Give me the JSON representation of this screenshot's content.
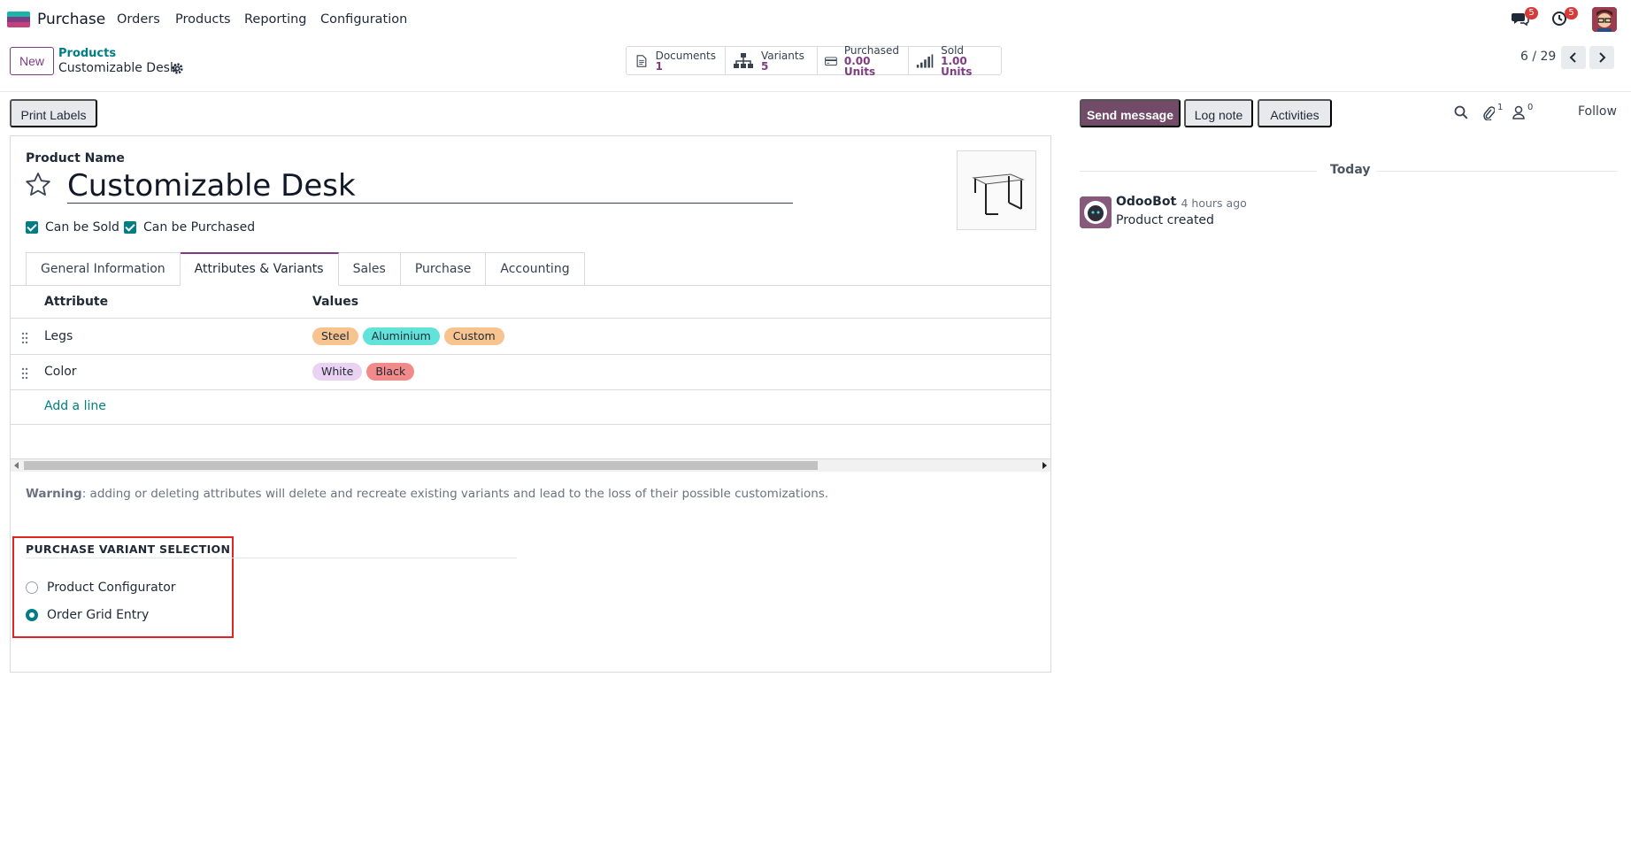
{
  "navbar": {
    "app_name": "Purchase",
    "menu": [
      "Orders",
      "Products",
      "Reporting",
      "Configuration"
    ],
    "messages_badge": "5",
    "activities_badge": "5"
  },
  "control_panel": {
    "new_label": "New",
    "breadcrumb_parent": "Products",
    "breadcrumb_current": "Customizable Desk",
    "smart_buttons": [
      {
        "label": "Documents",
        "value": "1",
        "icon": "file-icon"
      },
      {
        "label": "Variants",
        "value": "5",
        "icon": "sitemap-icon"
      },
      {
        "label": "Purchased",
        "value": "0.00 Units",
        "icon": "credit-card-icon"
      },
      {
        "label": "Sold",
        "value": "1.00 Units",
        "icon": "signal-icon"
      }
    ],
    "pager": "6 / 29"
  },
  "actions": {
    "print_labels": "Print Labels"
  },
  "form": {
    "product_name_label": "Product Name",
    "product_name": "Customizable Desk",
    "can_be_sold": "Can be Sold",
    "can_be_purchased": "Can be Purchased",
    "tabs": [
      "General Information",
      "Attributes & Variants",
      "Sales",
      "Purchase",
      "Accounting"
    ],
    "active_tab": "Attributes & Variants",
    "table": {
      "headers": [
        "Attribute",
        "Values"
      ],
      "rows": [
        {
          "attribute": "Legs",
          "values": [
            {
              "name": "Steel",
              "color": "#f7c38f"
            },
            {
              "name": "Aluminium",
              "color": "#62e3d9"
            },
            {
              "name": "Custom",
              "color": "#f7c38f"
            }
          ]
        },
        {
          "attribute": "Color",
          "values": [
            {
              "name": "White",
              "color": "#ead2f2"
            },
            {
              "name": "Black",
              "color": "#f28a8a"
            }
          ]
        }
      ],
      "add_line": "Add a line"
    },
    "warning_label": "Warning",
    "warning_text": ": adding or deleting attributes will delete and recreate existing variants and lead to the loss of their possible customizations.",
    "variant_section_title": "PURCHASE VARIANT SELECTION",
    "variant_options": [
      {
        "label": "Product Configurator",
        "selected": false
      },
      {
        "label": "Order Grid Entry",
        "selected": true
      }
    ]
  },
  "chatter": {
    "send_message": "Send message",
    "log_note": "Log note",
    "activities": "Activities",
    "attachments_count": "1",
    "followers_count": "0",
    "follow": "Follow",
    "date_separator": "Today",
    "messages": [
      {
        "author": "OdooBot",
        "time": "- 4 hours ago",
        "body": "Product created"
      }
    ]
  },
  "colors": {
    "brand": "#714b67",
    "accent": "#017e84",
    "highlight": "#e02424"
  }
}
